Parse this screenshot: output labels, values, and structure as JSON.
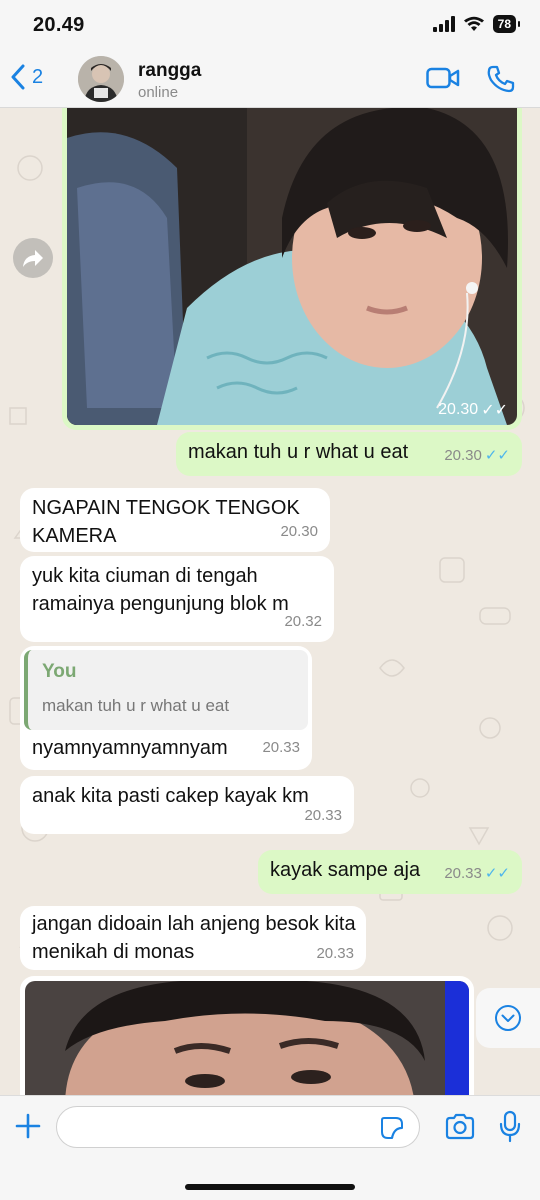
{
  "status_bar": {
    "time": "20.49",
    "battery": "78"
  },
  "header": {
    "back_count": "2",
    "contact_name": "rangga",
    "contact_status": "online"
  },
  "messages": [
    {
      "id": "m1",
      "direction": "out",
      "type": "image",
      "time": "20.30",
      "read": true
    },
    {
      "id": "m2",
      "direction": "out",
      "text": "makan tuh u r what u eat",
      "time": "20.30",
      "read": true
    },
    {
      "id": "m3",
      "direction": "in",
      "text": "NGAPAIN TENGOK TENGOK KAMERA",
      "time": "20.30"
    },
    {
      "id": "m4",
      "direction": "in",
      "text": "yuk kita ciuman di tengah ramainya pengunjung blok m",
      "time": "20.32"
    },
    {
      "id": "m5",
      "direction": "in",
      "quote_author": "You",
      "quote_text": "makan tuh u r what u eat",
      "text": "nyamnyamnyamnyam",
      "time": "20.33"
    },
    {
      "id": "m6",
      "direction": "in",
      "text": "anak kita pasti cakep kayak km",
      "time": "20.33"
    },
    {
      "id": "m7",
      "direction": "out",
      "text": "kayak sampe aja",
      "time": "20.33",
      "read": true
    },
    {
      "id": "m8",
      "direction": "in",
      "text": "jangan didoain lah anjeng besok kita menikah di monas",
      "time": "20.33"
    },
    {
      "id": "m9",
      "direction": "in",
      "type": "image"
    }
  ],
  "read_ticks": "✓✓",
  "composer": {
    "value": "",
    "placeholder": ""
  },
  "colors": {
    "accent": "#1a82e2",
    "outgoing_bubble": "#dcf8c6",
    "incoming_bubble": "#ffffff",
    "chat_background": "#efe9e1",
    "read_ticks": "#4fb6ec",
    "quote_accent": "#7ca873"
  },
  "icons": {
    "back": "chevron-left-icon",
    "video": "video-camera-icon",
    "call": "phone-icon",
    "forward": "forward-arrow-icon",
    "scroll": "chevron-down-icon",
    "plus": "plus-icon",
    "sticker": "sticker-icon",
    "camera": "camera-icon",
    "mic": "microphone-icon"
  }
}
